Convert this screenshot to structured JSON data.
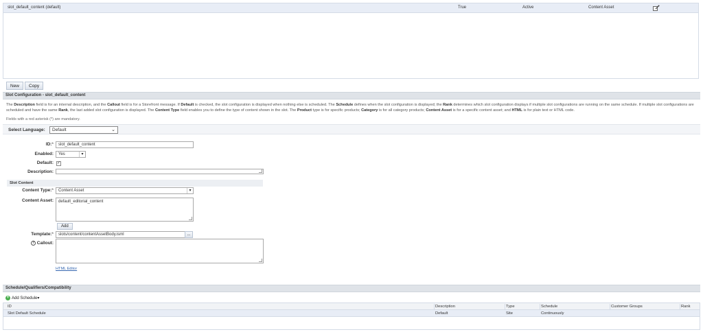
{
  "top_table": {
    "row": {
      "name": "slot_default_content (default)",
      "default": "True",
      "status": "Active",
      "type": "Content Asset",
      "icon": "edit-icon"
    }
  },
  "buttons": {
    "new": "New",
    "copy": "Copy"
  },
  "config": {
    "header": "Slot Configuration - slot_default_content",
    "description_parts": {
      "p1": "The ",
      "b1": "Description",
      "p2": " field is for an internal description, and the ",
      "b2": "Callout",
      "p3": " field is for a Storefront message. If ",
      "b3": "Default",
      "p4": " is checked, the slot configuration is displayed when nothing else is scheduled. The ",
      "b4": "Schedule",
      "p5": " defines when the slot configuration is displayed; the ",
      "b5": "Rank",
      "p6": " determines which slot configuration displays if multiple slot configurations are running on the same schedule. If multiple slot configurations are scheduled and have the same ",
      "b6": "Rank",
      "p7": ", the last added slot configuration is displayed. The ",
      "b7": "Content Type",
      "p8": " field enables you to define the type of content shown in the slot. The ",
      "b8": "Product",
      "p9": " type is for specific products; ",
      "b9": "Category",
      "p10": " is for all category products; ",
      "b10": "Content Asset",
      "p11": " is for a specific content asset; and ",
      "b11": "HTML",
      "p12": " is for plain text or HTML code."
    },
    "mandatory_note": "Fields with a red asterisk (*) are mandatory."
  },
  "language": {
    "label": "Select Language:",
    "value": "Default"
  },
  "form": {
    "id_label": "ID:",
    "id_value": "slot_default_content",
    "enabled_label": "Enabled:",
    "enabled_value": "Yes",
    "default_label": "Default:",
    "default_checked": "✓",
    "description_label": "Description:",
    "slot_content_header": "Slot Content",
    "content_type_label": "Content Type:",
    "content_type_value": "Content Asset",
    "content_asset_label": "Content Asset:",
    "content_asset_value": "default_editorial_content",
    "add_button": "Add",
    "template_label": "Template:",
    "template_value": "slots/content/contentAssetBody.isml",
    "template_browse": "...",
    "callout_label": "Callout:",
    "html_editor_link": "HTML Editor",
    "required_mark": "*"
  },
  "schedule": {
    "header": "Schedule/Qualifiers/Compatibility",
    "add_button": "Add Schedule",
    "columns": [
      "ID",
      "Description",
      "Type",
      "Schedule",
      "Customer Groups",
      "Rank"
    ],
    "rows": [
      [
        "Slot Default Schedule",
        "Default",
        "Site",
        "Continuously",
        "",
        ""
      ]
    ]
  }
}
